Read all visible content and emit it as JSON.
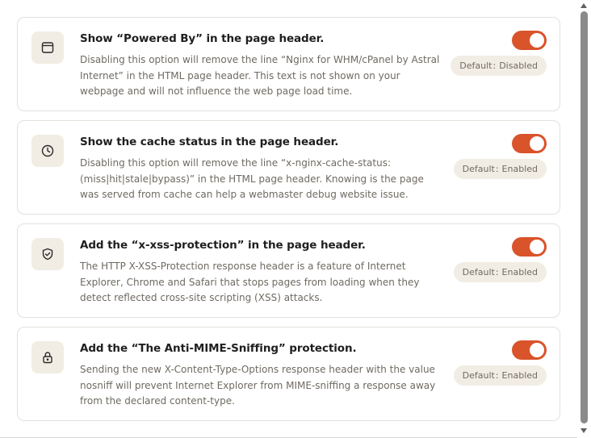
{
  "colors": {
    "accent": "#d9532b",
    "icon_bg": "#f2ede4",
    "badge_bg": "#f2ede4",
    "title": "#1f1f1f",
    "muted": "#6f6a62",
    "border": "#e3e1dc"
  },
  "settings": [
    {
      "icon": "browser-window-icon",
      "title": "Show “Powered By” in the page header.",
      "description": "Disabling this option will remove the line “Nginx for WHM/cPanel by Astral Internet” in the HTML page header. This text is not shown on your webpage and will not influence the web page load time.",
      "toggle_on": true,
      "default_label": "Default",
      "default_value": "Disabled"
    },
    {
      "icon": "clock-icon",
      "title": "Show the cache status in the page header.",
      "description": "Disabling this option will remove the line “x-nginx-cache-status: (miss|hit|stale|bypass)” in the HTML page header. Knowing is the page was served from cache can help a webmaster debug website issue.",
      "toggle_on": true,
      "default_label": "Default",
      "default_value": "Enabled"
    },
    {
      "icon": "shield-check-icon",
      "title": "Add the “x-xss-protection” in the page header.",
      "description": "The HTTP X-XSS-Protection response header is a feature of Internet Explorer, Chrome and Safari that stops pages from loading when they detect reflected cross-site scripting (XSS) attacks.",
      "toggle_on": true,
      "default_label": "Default",
      "default_value": "Enabled"
    },
    {
      "icon": "lock-icon",
      "title": "Add the “The Anti-MIME-Sniffing” protection.",
      "description": "Sending the new X-Content-Type-Options response header with the value nosniff will prevent Internet Explorer from MIME-sniffing a response away from the declared content-type.",
      "toggle_on": true,
      "default_label": "Default",
      "default_value": "Enabled"
    }
  ]
}
